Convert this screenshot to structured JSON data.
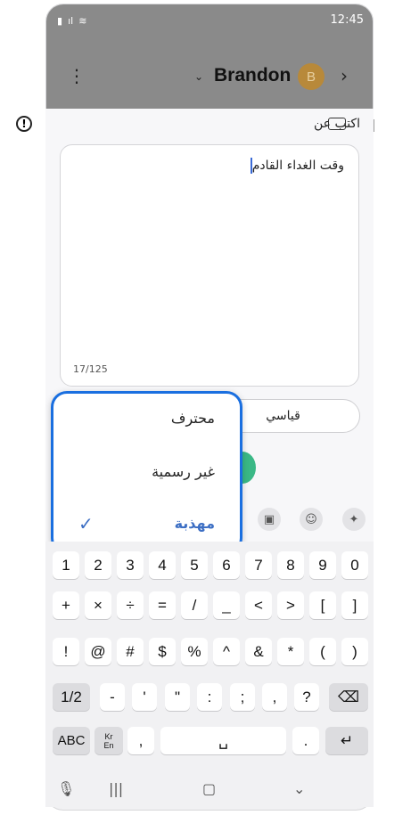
{
  "status": {
    "time": "12:45"
  },
  "header": {
    "contact_name": "Brandon",
    "avatar_letter": "B"
  },
  "compose": {
    "write_about_label": "اكتب عن",
    "text": "وقت الغداء القادم",
    "counter": "17/125"
  },
  "tone": {
    "current": "قياسي"
  },
  "tone_options": [
    {
      "label": "محترف",
      "selected": false
    },
    {
      "label": "غير رسمية",
      "selected": false
    },
    {
      "label": "مهذبة",
      "selected": true
    }
  ],
  "keyboard": {
    "row1": [
      "1",
      "2",
      "3",
      "4",
      "5",
      "6",
      "7",
      "8",
      "9",
      "0"
    ],
    "row2": [
      "+",
      "×",
      "÷",
      "=",
      "/",
      "_",
      "<",
      ">",
      "[",
      "]"
    ],
    "row3": [
      "!",
      "@",
      "#",
      "$",
      "%",
      "^",
      "&",
      "*",
      "(",
      ")"
    ],
    "row4": [
      "1/2",
      "-",
      "'",
      "\"",
      ":",
      ";",
      ",",
      "?"
    ],
    "row5": {
      "abc": "ABC",
      "lang_top": "Kr",
      "lang_bottom": "En",
      "comma": ",",
      "period": "."
    }
  },
  "colors": {
    "accent": "#1a6fe0",
    "selected_text": "#3d6fc4",
    "header_bg": "#8a8a8a",
    "send_green": "#3ab886"
  }
}
